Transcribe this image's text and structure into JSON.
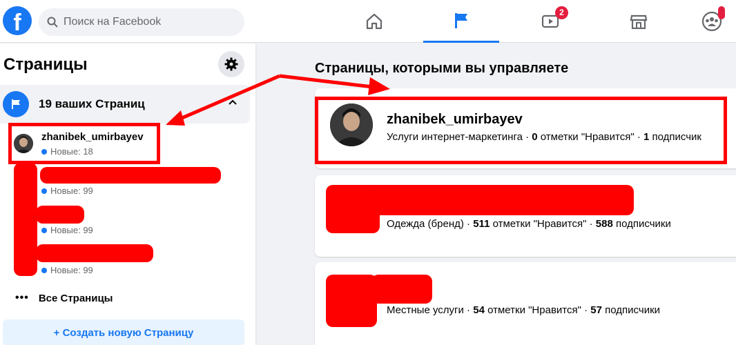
{
  "topbar": {
    "logo": "f",
    "search_placeholder": "Поиск на Facebook",
    "nav": [
      {
        "icon": "home-icon"
      },
      {
        "icon": "flag-icon",
        "active": true
      },
      {
        "icon": "watch-icon",
        "badge": "2"
      },
      {
        "icon": "marketplace-icon"
      },
      {
        "icon": "groups-icon"
      }
    ]
  },
  "sidebar": {
    "title": "Страницы",
    "pages_count_label": "19 ваших Страниц",
    "pages": [
      {
        "name": "zhanibek_umirbayev",
        "new_label": "Новые: 18"
      },
      {
        "name": "",
        "new_label": "Новые: 99"
      },
      {
        "name": "",
        "new_label": "Новые: 99"
      },
      {
        "name": "",
        "new_label": "Новые: 99"
      }
    ],
    "all_pages_label": "Все Страницы",
    "create_button_label": "+ Создать новую Страницу"
  },
  "main": {
    "title": "Страницы, которыми вы управляете",
    "cards": [
      {
        "name": "zhanibek_umirbayev",
        "category": "Услуги интернет-маркетинга",
        "likes": "0",
        "likes_label": "отметки \"Нравится\"",
        "followers": "1",
        "followers_label": "подписчик"
      },
      {
        "name": "",
        "category": "Одежда (бренд)",
        "likes": "511",
        "likes_label": "отметки \"Нравится\"",
        "followers": "588",
        "followers_label": "подписчики"
      },
      {
        "name": "",
        "category": "Местные услуги",
        "likes": "54",
        "likes_label": "отметки \"Нравится\"",
        "followers": "57",
        "followers_label": "подписчики"
      }
    ]
  },
  "colors": {
    "accent": "#1877f2",
    "highlight": "#ff0000",
    "badge": "#e41e3f"
  }
}
